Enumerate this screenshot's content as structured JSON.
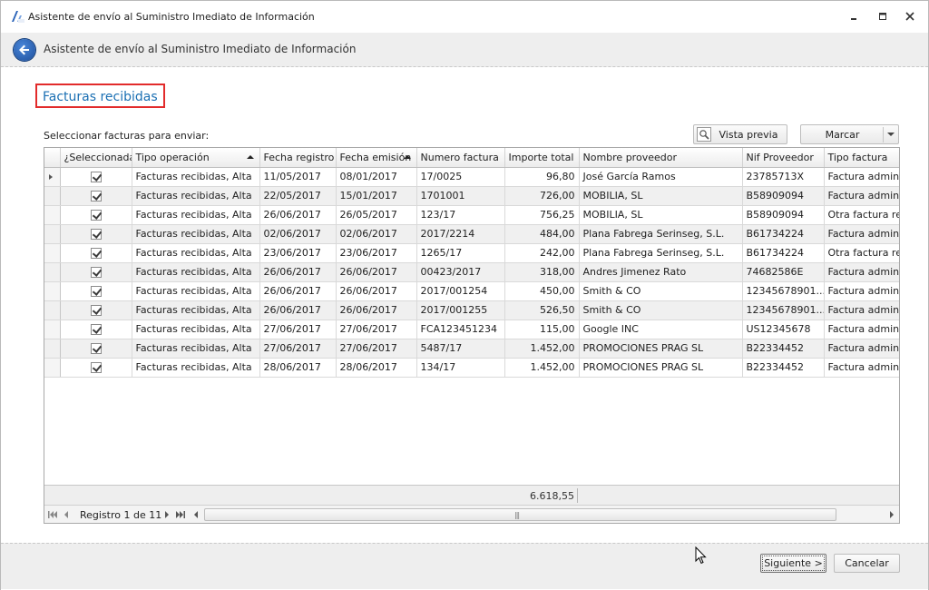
{
  "window": {
    "title": "Asistente de envío al Suministro Imediato de Información",
    "app_icon": "sii-app-icon",
    "controls": [
      "minimize-icon",
      "restore-icon",
      "close-icon"
    ]
  },
  "header": {
    "title": "Asistente de envío al Suministro Imediato de Información",
    "back_icon": "back-arrow-icon"
  },
  "section": {
    "title": "Facturas recibidas",
    "highlight_color": "#e22b2b",
    "title_color": "#1a6fb3"
  },
  "toolbar": {
    "select_label": "Seleccionar facturas para enviar:",
    "preview_label": "Vista previa",
    "preview_icon": "preview-icon",
    "mark_label": "Marcar",
    "mark_icon": "chevron-down-icon"
  },
  "grid": {
    "columns": [
      "¿Seleccionada?",
      "Tipo operación",
      "Fecha registro",
      "Fecha emisión",
      "Numero factura",
      "Importe total",
      "Nombre proveedor",
      "Nif Proveedor",
      "Tipo factura"
    ],
    "sorted_columns": [
      "Tipo operación",
      "Fecha emisión"
    ],
    "rows": [
      {
        "selected": true,
        "tipo": "Facturas recibidas, Alta",
        "fecha_registro": "11/05/2017",
        "fecha_emision": "08/01/2017",
        "numero": "17/0025",
        "importe": "96,80",
        "proveedor": "José García Ramos",
        "nif": "23785713X",
        "tipo_factura": "Factura administ"
      },
      {
        "selected": true,
        "tipo": "Facturas recibidas, Alta",
        "fecha_registro": "22/05/2017",
        "fecha_emision": "15/01/2017",
        "numero": "1701001",
        "importe": "726,00",
        "proveedor": "MOBILIA, SL",
        "nif": "B58909094",
        "tipo_factura": "Factura administ"
      },
      {
        "selected": true,
        "tipo": "Facturas recibidas, Alta",
        "fecha_registro": "26/06/2017",
        "fecha_emision": "26/05/2017",
        "numero": "123/17",
        "importe": "756,25",
        "proveedor": "MOBILIA, SL",
        "nif": "B58909094",
        "tipo_factura": "Otra factura reci"
      },
      {
        "selected": true,
        "tipo": "Facturas recibidas, Alta",
        "fecha_registro": "02/06/2017",
        "fecha_emision": "02/06/2017",
        "numero": "2017/2214",
        "importe": "484,00",
        "proveedor": "Plana Fabrega Serinseg, S.L.",
        "nif": "B61734224",
        "tipo_factura": "Factura administ"
      },
      {
        "selected": true,
        "tipo": "Facturas recibidas, Alta",
        "fecha_registro": "23/06/2017",
        "fecha_emision": "23/06/2017",
        "numero": "1265/17",
        "importe": "242,00",
        "proveedor": "Plana Fabrega Serinseg, S.L.",
        "nif": "B61734224",
        "tipo_factura": "Otra factura reci"
      },
      {
        "selected": true,
        "tipo": "Facturas recibidas, Alta",
        "fecha_registro": "26/06/2017",
        "fecha_emision": "26/06/2017",
        "numero": "00423/2017",
        "importe": "318,00",
        "proveedor": "Andres Jimenez Rato",
        "nif": "74682586E",
        "tipo_factura": "Factura administ"
      },
      {
        "selected": true,
        "tipo": "Facturas recibidas, Alta",
        "fecha_registro": "26/06/2017",
        "fecha_emision": "26/06/2017",
        "numero": "2017/001254",
        "importe": "450,00",
        "proveedor": "Smith & CO",
        "nif": "12345678901...",
        "tipo_factura": "Factura administ"
      },
      {
        "selected": true,
        "tipo": "Facturas recibidas, Alta",
        "fecha_registro": "26/06/2017",
        "fecha_emision": "26/06/2017",
        "numero": "2017/001255",
        "importe": "526,50",
        "proveedor": "Smith & CO",
        "nif": "12345678901...",
        "tipo_factura": "Factura administ"
      },
      {
        "selected": true,
        "tipo": "Facturas recibidas, Alta",
        "fecha_registro": "27/06/2017",
        "fecha_emision": "27/06/2017",
        "numero": "FCA123451234",
        "importe": "115,00",
        "proveedor": "Google INC",
        "nif": "US12345678",
        "tipo_factura": "Factura administ"
      },
      {
        "selected": true,
        "tipo": "Facturas recibidas, Alta",
        "fecha_registro": "27/06/2017",
        "fecha_emision": "27/06/2017",
        "numero": "5487/17",
        "importe": "1.452,00",
        "proveedor": "PROMOCIONES PRAG SL",
        "nif": "B22334452",
        "tipo_factura": "Factura administ"
      },
      {
        "selected": true,
        "tipo": "Facturas recibidas, Alta",
        "fecha_registro": "28/06/2017",
        "fecha_emision": "28/06/2017",
        "numero": "134/17",
        "importe": "1.452,00",
        "proveedor": "PROMOCIONES PRAG SL",
        "nif": "B22334452",
        "tipo_factura": "Factura administ"
      }
    ],
    "total": "6.618,55"
  },
  "navigator": {
    "record_text": "Registro 1 de 11",
    "icons": [
      "first-record-icon",
      "previous-record-icon",
      "next-record-icon",
      "last-record-icon"
    ]
  },
  "footer": {
    "next_label": "Siguiente >",
    "cancel_label": "Cancelar"
  }
}
